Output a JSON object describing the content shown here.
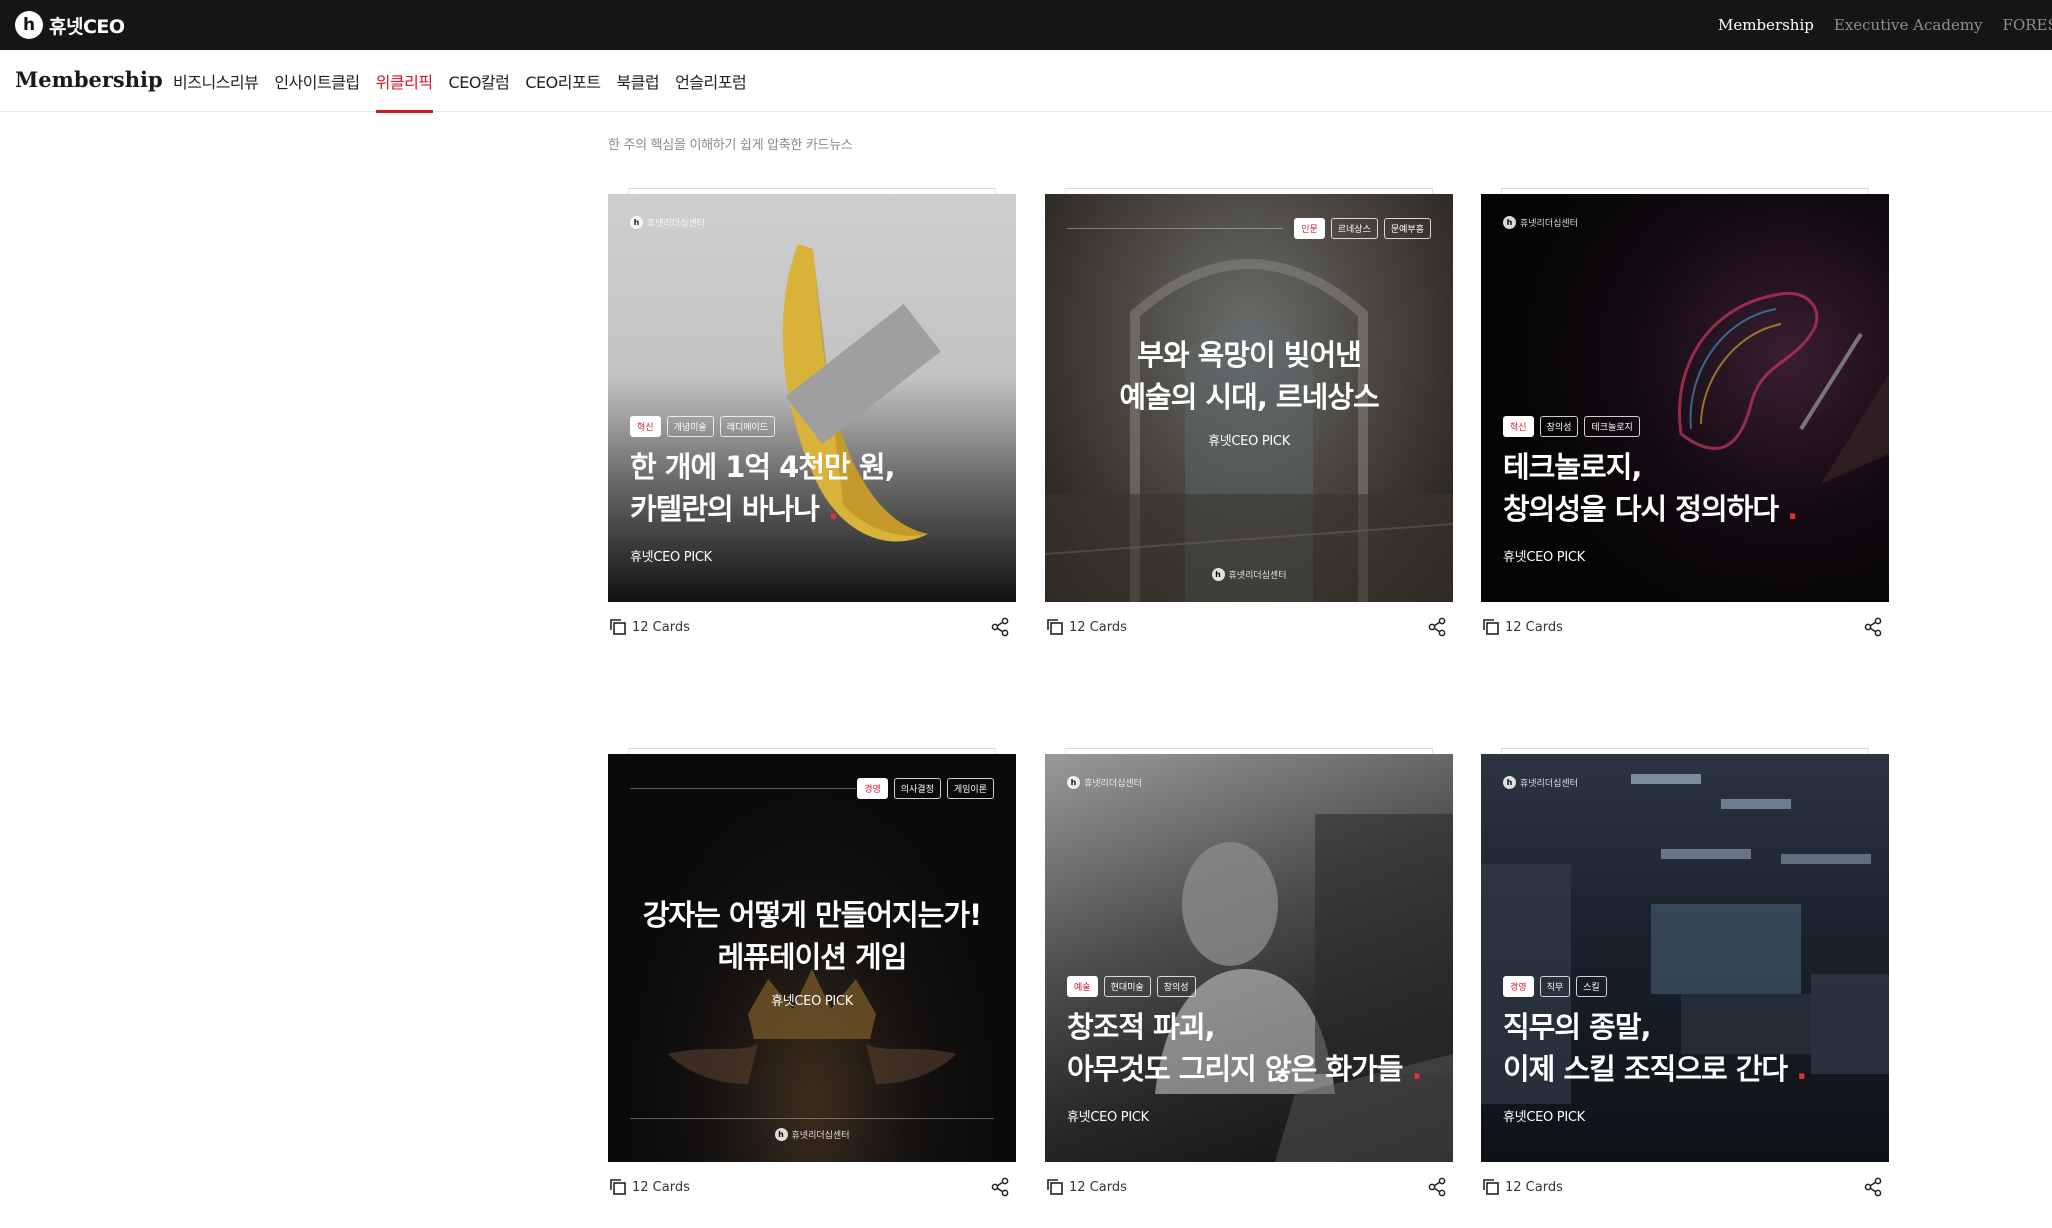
{
  "header": {
    "logo_mark": "h",
    "logo_text": "휴넷CEO",
    "links": [
      "Membership",
      "Executive Academy",
      "FORESIGHT"
    ]
  },
  "subnav": {
    "title": "Membership",
    "items": [
      "비즈니스리뷰",
      "인사이트클립",
      "위클리픽",
      "CEO칼럼",
      "CEO리포트",
      "북클럽",
      "언슬리포럼"
    ],
    "active_index": 2
  },
  "section": {
    "subtitle": "한 주의 핵심을 이해하기 쉽게 압축한 카드뉴스"
  },
  "brand_small": "휴넷리더십센터",
  "cards": [
    {
      "tags": [
        "혁신",
        "개념미술",
        "레디메이드"
      ],
      "line1": "한 개에 1억 4천만 원,",
      "line2": "카텔란의 바나나",
      "pick": "휴넷CEO PICK",
      "count": "12 Cards"
    },
    {
      "tags": [
        "인문",
        "르네상스",
        "문예부흥"
      ],
      "line1": "부와 욕망이 빚어낸",
      "line2": "예술의 시대, 르네상스",
      "pick": "휴넷CEO PICK",
      "count": "12 Cards"
    },
    {
      "tags": [
        "혁신",
        "창의성",
        "테크놀로지"
      ],
      "line1": "테크놀로지,",
      "line2": "창의성을 다시 정의하다",
      "pick": "휴넷CEO PICK",
      "count": "12 Cards"
    },
    {
      "tags": [
        "경영",
        "의사결정",
        "게임이론"
      ],
      "line1": "강자는 어떻게 만들어지는가!",
      "line2": "레퓨테이션 게임",
      "pick": "휴넷CEO PICK",
      "count": "12 Cards"
    },
    {
      "tags": [
        "예술",
        "현대미술",
        "창의성"
      ],
      "line1": "창조적 파괴,",
      "line2": "아무것도 그리지 않은 화가들",
      "pick": "휴넷CEO PICK",
      "count": "12 Cards"
    },
    {
      "tags": [
        "경영",
        "직무",
        "스킬"
      ],
      "line1": "직무의 종말,",
      "line2": "이제 스킬 조직으로 간다",
      "pick": "휴넷CEO PICK",
      "count": "12 Cards"
    }
  ],
  "colors": {
    "accent": "#d11a2a",
    "topbar": "#151515"
  },
  "icons": {
    "count": "cards-stack-icon",
    "share": "share-icon"
  }
}
